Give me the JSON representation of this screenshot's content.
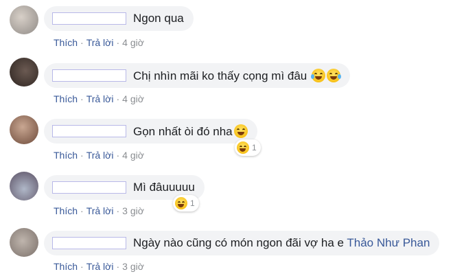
{
  "comments": [
    {
      "text": "Ngon qua",
      "like": "Thích",
      "reply": "Trả lời",
      "time": "4 giờ"
    },
    {
      "text": "Chị nhìn mãi ko thấy cọng mì đâu",
      "like": "Thích",
      "reply": "Trả lời",
      "time": "4 giờ"
    },
    {
      "text": "Gọn nhất òi đó nha",
      "like": "Thích",
      "reply": "Trả lời",
      "time": "4 giờ",
      "reaction_count": "1"
    },
    {
      "text": "Mì đâuuuuu",
      "like": "Thích",
      "reply": "Trả lời",
      "time": "3 giờ",
      "reaction_count": "1"
    },
    {
      "text": "Ngày nào cũng có món ngon đãi vợ ha e",
      "mention": "Thảo Như Phan",
      "like": "Thích",
      "reply": "Trả lời",
      "time": "3 giờ"
    }
  ],
  "separator": "·",
  "colors": {
    "bubble": "#f2f3f5",
    "link": "#385898",
    "meta": "#8a8d91"
  }
}
